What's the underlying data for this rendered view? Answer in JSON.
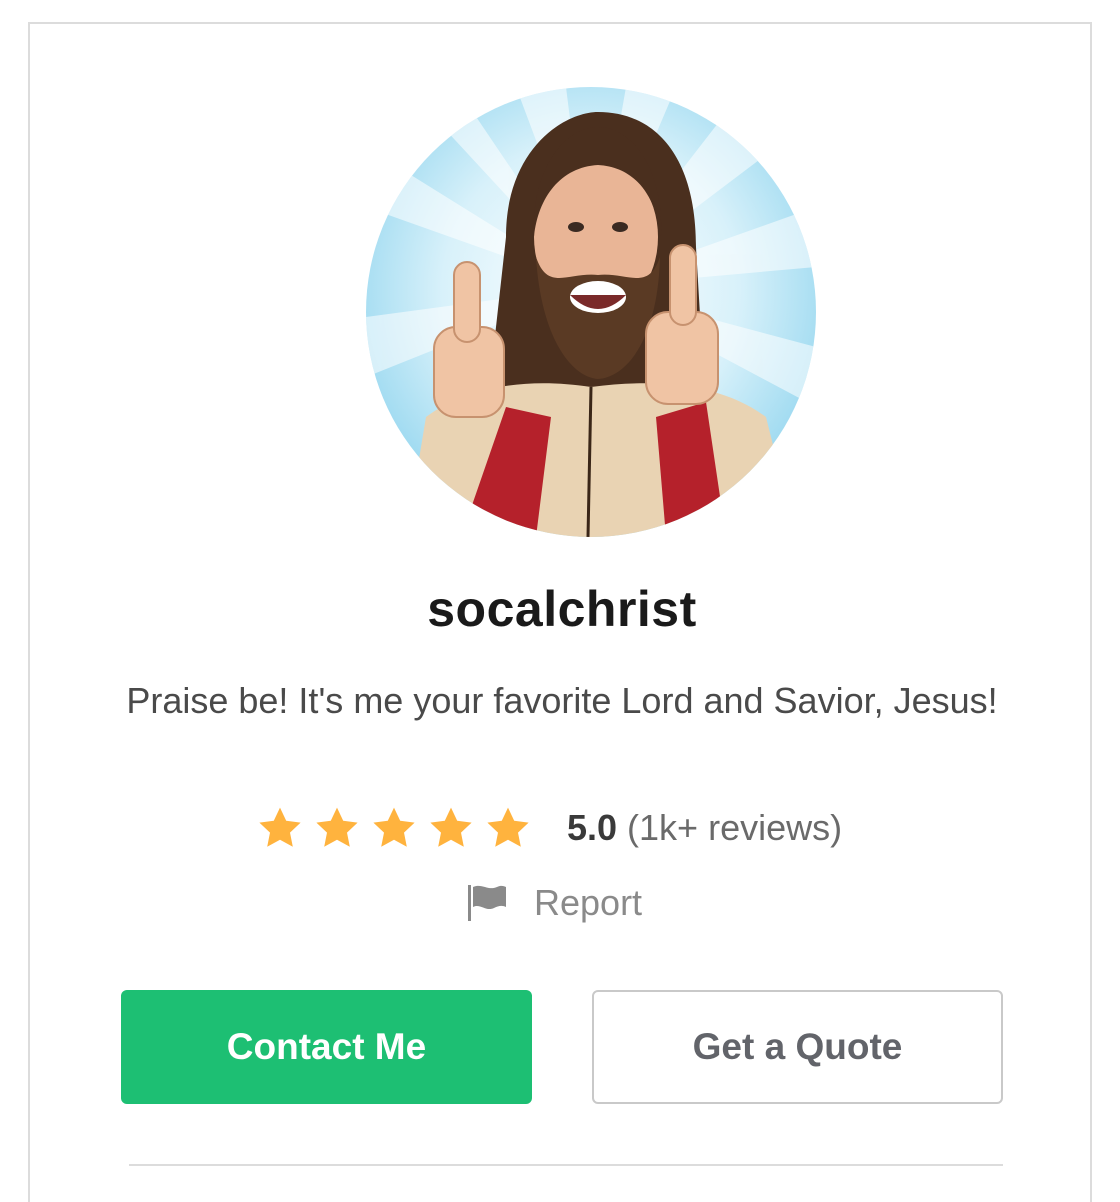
{
  "profile": {
    "avatar_alt": "Profile photo of a smiling man in robe giving two thumbs up",
    "username": "socalchrist",
    "tagline": "Praise be! It's me your favorite Lord and Savior, Jesus!"
  },
  "rating": {
    "stars": 5,
    "value": "5.0",
    "count_label": "(1k+ reviews)",
    "star_color": "#ffb33e"
  },
  "report": {
    "label": "Report",
    "icon": "flag-icon"
  },
  "actions": {
    "contact_label": "Contact Me",
    "quote_label": "Get a Quote",
    "contact_color": "#1dbf73"
  }
}
